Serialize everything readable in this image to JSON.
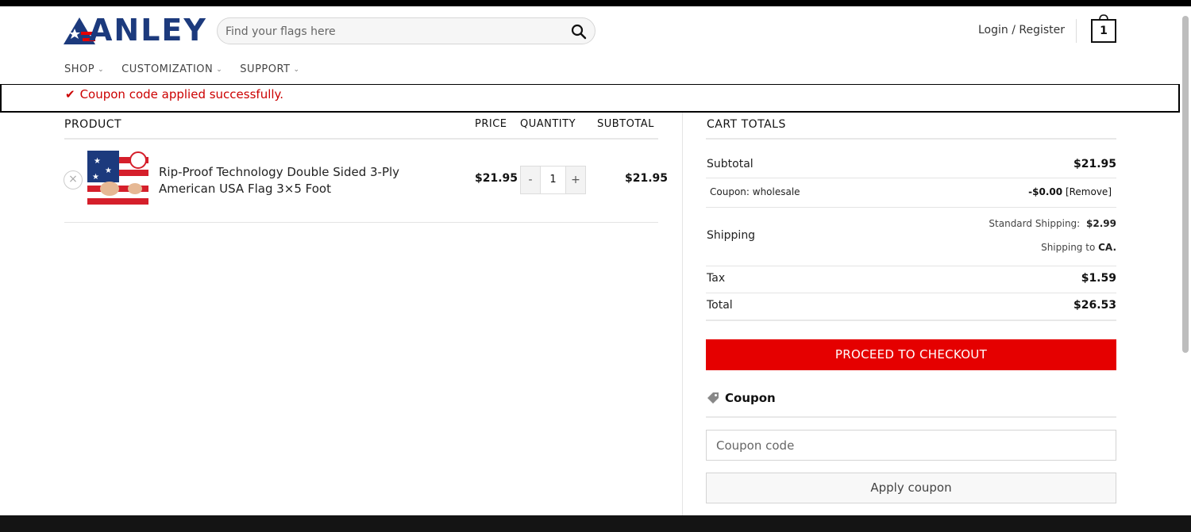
{
  "brand": {
    "logo_text": "ANLEY",
    "accent": "#e50000",
    "navy": "#1c3a7d"
  },
  "header": {
    "search_placeholder": "Find your flags here",
    "login_label": "Login / Register",
    "cart_count": "1"
  },
  "nav": {
    "items": [
      "SHOP",
      "CUSTOMIZATION",
      "SUPPORT"
    ]
  },
  "notice": {
    "message": "Coupon code applied successfully.",
    "color": "#cc0000"
  },
  "cart": {
    "headers": {
      "product": "PRODUCT",
      "price": "PRICE",
      "quantity": "QUANTITY",
      "subtotal": "SUBTOTAL"
    },
    "items": [
      {
        "remove": "×",
        "name": "Rip-Proof Technology Double Sided 3-Ply American USA Flag 3×5 Foot",
        "price": "$21.95",
        "qty_minus": "-",
        "quantity": "1",
        "qty_plus": "+",
        "subtotal": "$21.95"
      }
    ]
  },
  "totals": {
    "title": "CART TOTALS",
    "subtotal_label": "Subtotal",
    "subtotal_value": "$21.95",
    "coupon_label": "Coupon: wholesale",
    "coupon_value": "-$0.00",
    "coupon_remove": "[Remove]",
    "shipping_label": "Shipping",
    "shipping_method": "Standard Shipping:",
    "shipping_value": "$2.99",
    "shipping_to": "Shipping to",
    "shipping_dest": "CA.",
    "tax_label": "Tax",
    "tax_value": "$1.59",
    "total_label": "Total",
    "total_value": "$26.53",
    "checkout_label": "PROCEED TO CHECKOUT"
  },
  "coupon": {
    "heading": "Coupon",
    "placeholder": "Coupon code",
    "apply_label": "Apply coupon"
  }
}
